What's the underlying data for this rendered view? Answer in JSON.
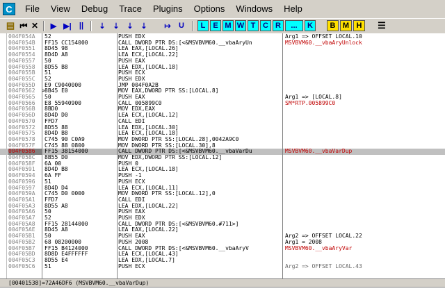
{
  "app": {
    "icon_letter": "C"
  },
  "menu": [
    "File",
    "View",
    "Debug",
    "Trace",
    "Plugins",
    "Options",
    "Windows",
    "Help"
  ],
  "toolbar": {
    "plain": [
      "▶",
      "▶|",
      "||",
      "⇣",
      "⇣",
      "⇣",
      "⇣",
      "↦",
      "U"
    ],
    "cyan": [
      "L",
      "E",
      "M",
      "W",
      "T",
      "C",
      "R",
      "...",
      "K"
    ],
    "yellow": [
      "B",
      "M",
      "H"
    ]
  },
  "rows": [
    {
      "addr": "004F054A",
      "mark": "",
      "hex": "52",
      "dis": "PUSH EDX",
      "cmt": "Arg1 => OFFSET LOCAL.10",
      "cc": "black"
    },
    {
      "addr": "004F054B",
      "mark": "",
      "hex": "FF15 CC154000",
      "dis": "CALL DWORD PTR DS:[<&MSVBVM60.__vbaAryUn",
      "cmt": "MSVBVM60.__vbaAryUnlock",
      "cc": "red"
    },
    {
      "addr": "004F0551",
      "mark": "",
      "hex": "8D45 98",
      "dis": "LEA EAX,[LOCAL.26]",
      "cmt": "",
      "cc": "black"
    },
    {
      "addr": "004F0554",
      "mark": "",
      "hex": "8D4D A8",
      "dis": "LEA ECX,[LOCAL.22]",
      "cmt": "",
      "cc": "black"
    },
    {
      "addr": "004F0557",
      "mark": "",
      "hex": "50",
      "dis": "PUSH EAX",
      "cmt": "",
      "cc": "black"
    },
    {
      "addr": "004F0558",
      "mark": "",
      "hex": "8D55 B8",
      "dis": "LEA EDX,[LOCAL.18]",
      "cmt": "",
      "cc": "black"
    },
    {
      "addr": "004F055B",
      "mark": "",
      "hex": "51",
      "dis": "PUSH ECX",
      "cmt": "",
      "cc": "black"
    },
    {
      "addr": "004F055C",
      "mark": "",
      "hex": "52",
      "dis": "PUSH EDX",
      "cmt": "",
      "cc": "black"
    },
    {
      "addr": "004F055D",
      "mark": "",
      "hex": "E9 C9040000",
      "dis": "JMP 004F0A2B",
      "cmt": "",
      "cc": "black"
    },
    {
      "addr": "004F0562",
      "mark": ">",
      "hex": "8B45 E0",
      "dis": "MOV EAX,DWORD PTR SS:[LOCAL.8]",
      "cmt": "",
      "cc": "black"
    },
    {
      "addr": "004F0565",
      "mark": "",
      "hex": "50",
      "dis": "PUSH EAX",
      "cmt": "Arg1 => [LOCAL.8]",
      "cc": "black"
    },
    {
      "addr": "004F0566",
      "mark": "",
      "hex": "E8 55940900",
      "dis": "CALL 005899C0",
      "cmt": "SM*RTP.005899C0",
      "cc": "red"
    },
    {
      "addr": "004F056B",
      "mark": "",
      "hex": "8BD0",
      "dis": "MOV EDX,EAX",
      "cmt": "",
      "cc": "black"
    },
    {
      "addr": "004F056D",
      "mark": "",
      "hex": "8D4D D0",
      "dis": "LEA ECX,[LOCAL.12]",
      "cmt": "",
      "cc": "black"
    },
    {
      "addr": "004F0570",
      "mark": "",
      "hex": "FFD7",
      "dis": "CALL EDI",
      "cmt": "",
      "cc": "black"
    },
    {
      "addr": "004F0572",
      "mark": "",
      "hex": "8D55 88",
      "dis": "LEA EDX,[LOCAL.30]",
      "cmt": "",
      "cc": "black"
    },
    {
      "addr": "004F0575",
      "mark": "",
      "hex": "8D4D B8",
      "dis": "LEA ECX,[LOCAL.18]",
      "cmt": "",
      "cc": "black"
    },
    {
      "addr": "004F0578",
      "mark": "",
      "hex": "C745 90 C0A9",
      "dis": "MOV DWORD PTR SS:[LOCAL.28],0042A9C0",
      "cmt": "",
      "cc": "black"
    },
    {
      "addr": "004F057F",
      "mark": "",
      "hex": "C745 88 0800",
      "dis": "MOV DWORD PTR SS:[LOCAL.30],8",
      "cmt": "",
      "cc": "black"
    },
    {
      "addr": "004F0586",
      "mark": "",
      "hex": "FF15 38154000",
      "dis": "CALL DWORD PTR DS:[<&MSVBVM60.__vbaVarDu",
      "cmt": "MSVBVM60.__vbaVarDup",
      "cc": "red",
      "sel": true
    },
    {
      "addr": "004F058C",
      "mark": "",
      "hex": "8B55 D0",
      "dis": "MOV EDX,DWORD PTR SS:[LOCAL.12]",
      "cmt": "",
      "cc": "black"
    },
    {
      "addr": "004F058F",
      "mark": "",
      "hex": "6A 00",
      "dis": "PUSH 0",
      "cmt": "",
      "cc": "black"
    },
    {
      "addr": "004F0591",
      "mark": "",
      "hex": "8D4D B8",
      "dis": "LEA ECX,[LOCAL.18]",
      "cmt": "",
      "cc": "black"
    },
    {
      "addr": "004F0594",
      "mark": "",
      "hex": "6A FF",
      "dis": "PUSH -1",
      "cmt": "",
      "cc": "black"
    },
    {
      "addr": "004F0596",
      "mark": "",
      "hex": "51",
      "dis": "PUSH ECX",
      "cmt": "",
      "cc": "black"
    },
    {
      "addr": "004F0597",
      "mark": "",
      "hex": "8D4D D4",
      "dis": "LEA ECX,[LOCAL.11]",
      "cmt": "",
      "cc": "black"
    },
    {
      "addr": "004F059A",
      "mark": "",
      "hex": "C745 D0 0000",
      "dis": "MOV DWORD PTR SS:[LOCAL.12],0",
      "cmt": "",
      "cc": "black"
    },
    {
      "addr": "004F05A1",
      "mark": "",
      "hex": "FFD7",
      "dis": "CALL EDI",
      "cmt": "",
      "cc": "black"
    },
    {
      "addr": "004F05A3",
      "mark": "",
      "hex": "8D55 A8",
      "dis": "LEA EDX,[LOCAL.22]",
      "cmt": "",
      "cc": "black"
    },
    {
      "addr": "004F05A6",
      "mark": "",
      "hex": "50",
      "dis": "PUSH EAX",
      "cmt": "",
      "cc": "black"
    },
    {
      "addr": "004F05A7",
      "mark": "",
      "hex": "52",
      "dis": "PUSH EDX",
      "cmt": "",
      "cc": "black"
    },
    {
      "addr": "004F05A8",
      "mark": "",
      "hex": "FF15 28144000",
      "dis": "CALL DWORD PTR DS:[<&MSVBVM60.#711>]",
      "cmt": "",
      "cc": "black"
    },
    {
      "addr": "004F05AE",
      "mark": "",
      "hex": "8D45 A8",
      "dis": "LEA EAX,[LOCAL.22]",
      "cmt": "",
      "cc": "black"
    },
    {
      "addr": "004F05B1",
      "mark": "",
      "hex": "50",
      "dis": "PUSH EAX",
      "cmt": "Arg2 => OFFSET LOCAL.22",
      "cc": "black"
    },
    {
      "addr": "004F05B2",
      "mark": "",
      "hex": "68 08200000",
      "dis": "PUSH 2008",
      "cmt": "Arg1 = 2008",
      "cc": "black"
    },
    {
      "addr": "004F05B7",
      "mark": "",
      "hex": "FF15 B4124000",
      "dis": "CALL DWORD PTR DS:[<&MSVBVM60.__vbaAryV",
      "cmt": "MSVBVM60.__vbaAryVar",
      "cc": "red"
    },
    {
      "addr": "004F05BD",
      "mark": "",
      "hex": "8D8D E4FFFFFF",
      "dis": "LEA ECX,[LOCAL.43]",
      "cmt": "",
      "cc": "black"
    },
    {
      "addr": "004F05C3",
      "mark": "",
      "hex": "8D55 E4",
      "dis": "LEA EDX,[LOCAL.7]",
      "cmt": "",
      "cc": "black"
    },
    {
      "addr": "004F05C6",
      "mark": "",
      "hex": "51",
      "dis": "PUSH ECX",
      "cmt": "Arg2 => OFFSET LOCAL.43",
      "cc": "gray"
    }
  ],
  "status_text": "[00401538]=72A46DF6 (MSVBVM60.__vbaVarDup)"
}
